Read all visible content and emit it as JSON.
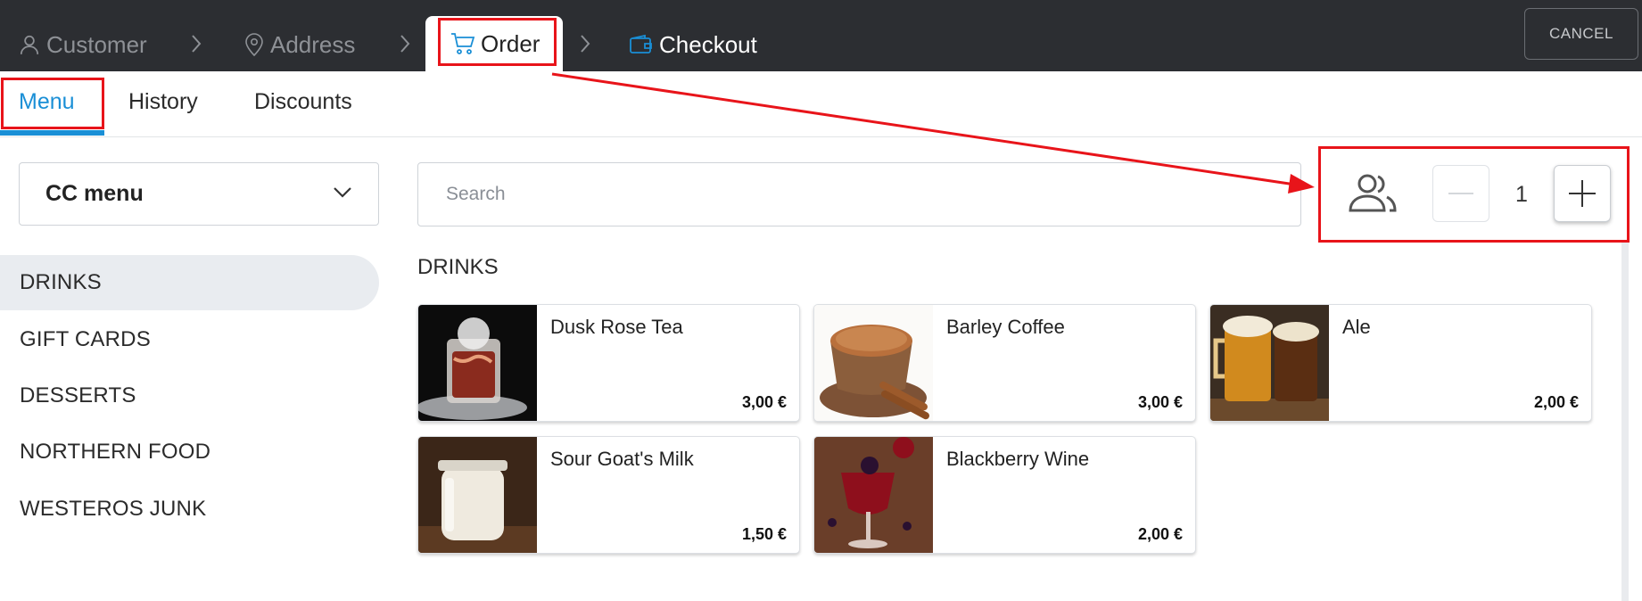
{
  "wizard": {
    "steps": [
      {
        "label": "Customer",
        "icon": "person-icon"
      },
      {
        "label": "Address",
        "icon": "location-pin-icon"
      },
      {
        "label": "Order",
        "icon": "cart-icon"
      },
      {
        "label": "Checkout",
        "icon": "wallet-icon"
      }
    ],
    "cancel_label": "CANCEL"
  },
  "tabs": [
    {
      "label": "Menu",
      "active": true
    },
    {
      "label": "History",
      "active": false
    },
    {
      "label": "Discounts",
      "active": false
    }
  ],
  "menu_select": {
    "value": "CC menu"
  },
  "categories": [
    {
      "label": "DRINKS",
      "active": true
    },
    {
      "label": "GIFT CARDS",
      "active": false
    },
    {
      "label": "DESSERTS",
      "active": false
    },
    {
      "label": "NORTHERN FOOD",
      "active": false
    },
    {
      "label": "WESTEROS JUNK",
      "active": false
    }
  ],
  "search": {
    "placeholder": "Search",
    "value": ""
  },
  "section_title": "DRINKS",
  "guests": {
    "icon": "people-icon",
    "count": "1"
  },
  "products": [
    {
      "name": "Dusk Rose Tea",
      "price": "3,00 €",
      "image": "smoky-tea-glass"
    },
    {
      "name": "Barley Coffee",
      "price": "3,00 €",
      "image": "coffee-cup-cinnamon"
    },
    {
      "name": "Ale",
      "price": "2,00 €",
      "image": "beer-mugs"
    },
    {
      "name": "Sour Goat's Milk",
      "price": "1,50 €",
      "image": "milk-jar"
    },
    {
      "name": "Blackberry Wine",
      "price": "2,00 €",
      "image": "blackberry-wine-glass"
    }
  ],
  "colors": {
    "accent": "#1a8fd6",
    "topbar": "#2c2e32",
    "annotation": "#e8141a"
  }
}
